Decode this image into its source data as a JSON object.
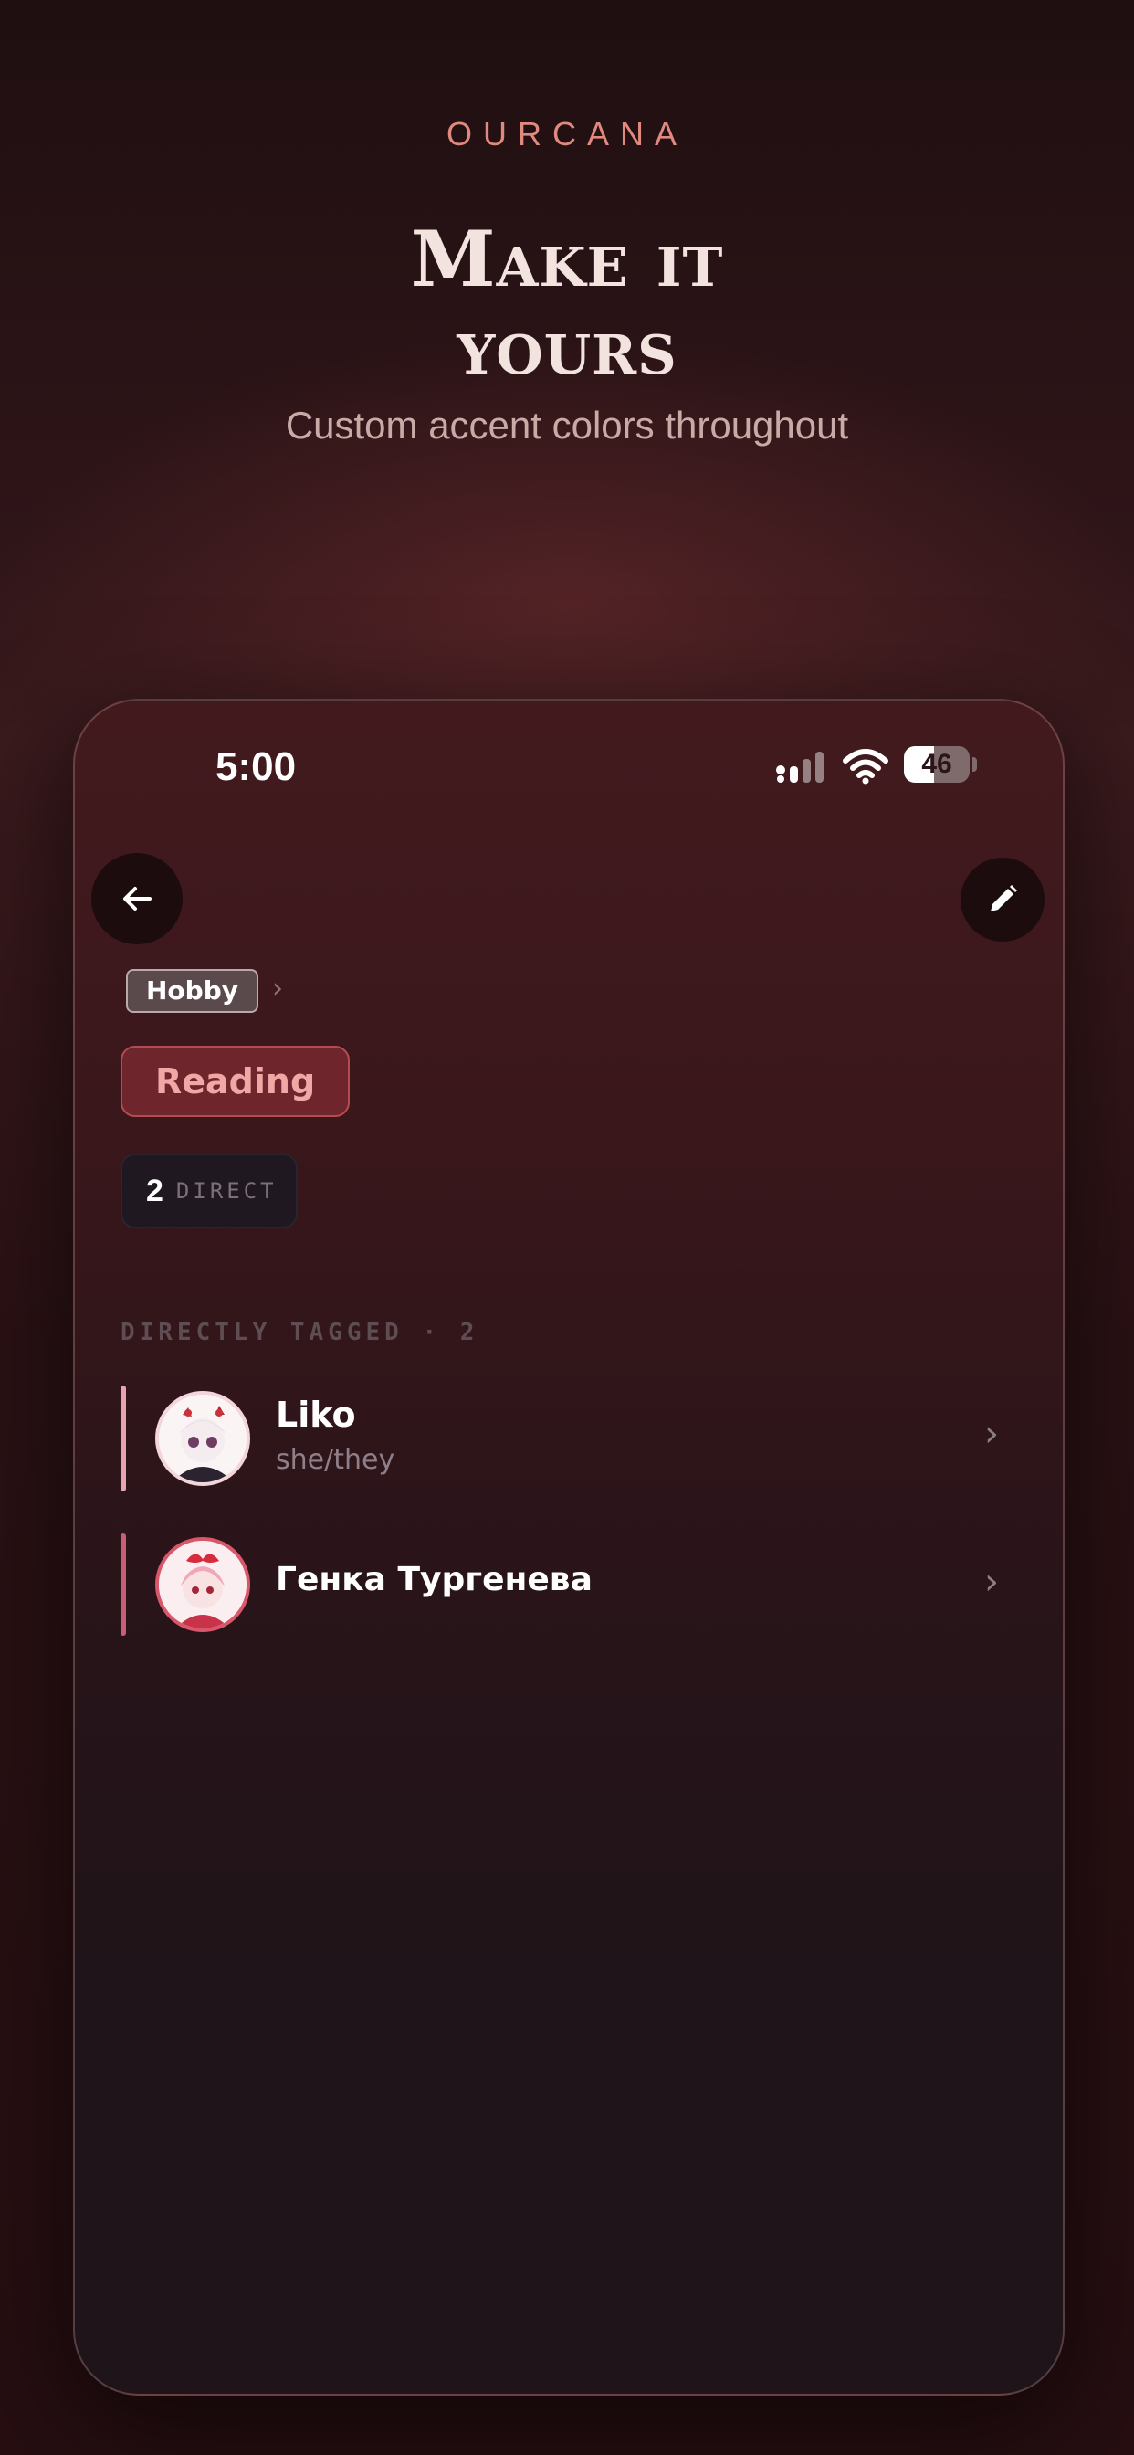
{
  "promo": {
    "brand": "OURCANA",
    "headline_line1": "Make it",
    "headline_line2": "yours",
    "subtitle": "Custom accent colors throughout"
  },
  "status_bar": {
    "time": "5:00",
    "battery": "46"
  },
  "header": {
    "back_icon": "arrow-left-icon",
    "edit_icon": "pencil-icon"
  },
  "breadcrumb": {
    "parent_label": "Hobby",
    "chevron": "›"
  },
  "tag": {
    "name": "Reading",
    "accent_color": "#b54a52"
  },
  "stats": {
    "direct_count": "2",
    "direct_label": "DIRECT"
  },
  "section": {
    "title": "DIRECTLY TAGGED · 2"
  },
  "members": [
    {
      "name": "Liko",
      "pronouns": "she/they",
      "accent_color": "#e8a3b1",
      "avatar": "anime-avatar-white-hair"
    },
    {
      "name": "Генка Тургенева",
      "pronouns": "",
      "accent_color": "#c95f74",
      "avatar": "anime-avatar-pink-hair"
    }
  ],
  "row_chevron": "›"
}
